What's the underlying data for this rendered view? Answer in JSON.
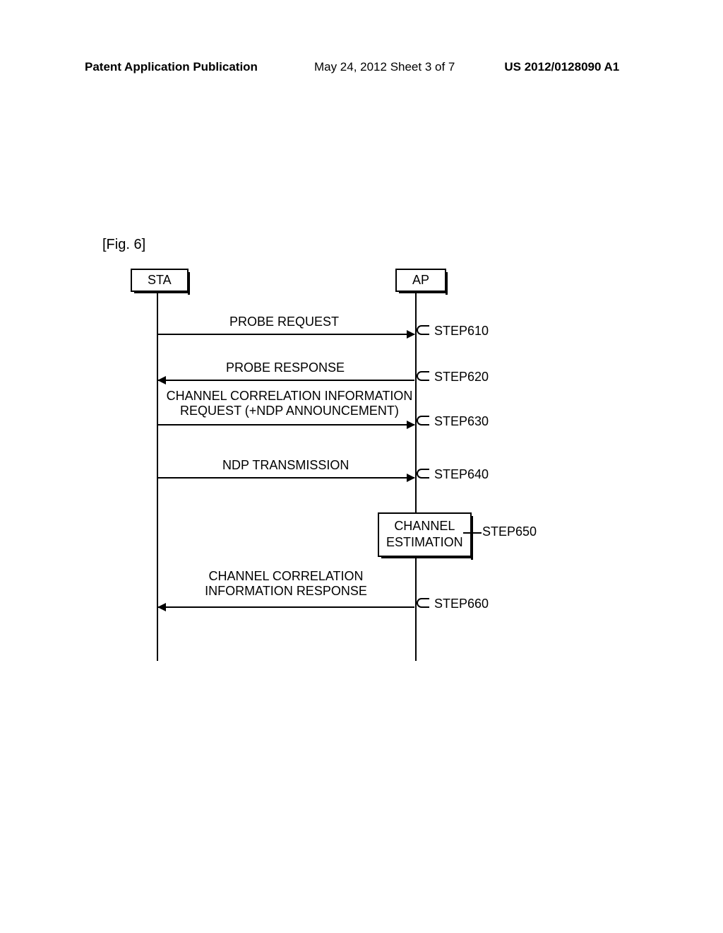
{
  "header": {
    "left": "Patent Application Publication",
    "center": "May 24, 2012 Sheet 3 of 7",
    "right": "US 2012/0128090 A1"
  },
  "figure_label": "[Fig. 6]",
  "entities": {
    "sta": "STA",
    "ap": "AP"
  },
  "messages": {
    "probe_request": "PROBE REQUEST",
    "probe_response": "PROBE RESPONSE",
    "channel_corr_req_line1": "CHANNEL CORRELATION INFORMATION",
    "channel_corr_req_line2": "REQUEST (+NDP ANNOUNCEMENT)",
    "ndp_transmission": "NDP TRANSMISSION",
    "channel_estimation_line1": "CHANNEL",
    "channel_estimation_line2": "ESTIMATION",
    "channel_corr_resp_line1": "CHANNEL CORRELATION",
    "channel_corr_resp_line2": "INFORMATION RESPONSE"
  },
  "steps": {
    "s610": "STEP610",
    "s620": "STEP620",
    "s630": "STEP630",
    "s640": "STEP640",
    "s650": "STEP650",
    "s660": "STEP660"
  }
}
